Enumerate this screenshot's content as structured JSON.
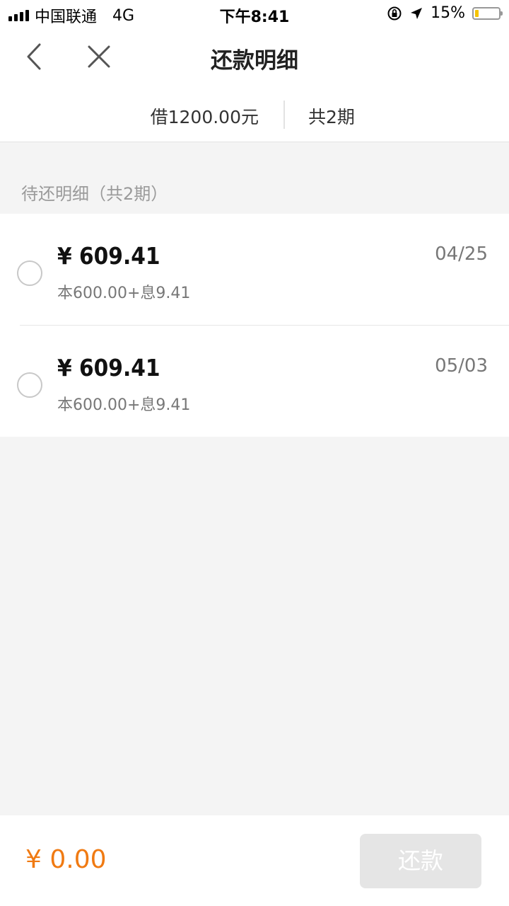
{
  "status_bar": {
    "carrier": "中国联通",
    "network": "4G",
    "time": "下午8:41",
    "battery_percent": "15%",
    "battery_level": 0.15,
    "icons": [
      "signal-icon",
      "orientation-lock-icon",
      "location-arrow-icon",
      "battery-icon"
    ]
  },
  "nav": {
    "title": "还款明细",
    "back_icon": "chevron-left-icon",
    "close_icon": "close-icon"
  },
  "summary": {
    "loan": "借1200.00元",
    "periods": "共2期"
  },
  "section": {
    "title": "待还明细（共2期）"
  },
  "installments": [
    {
      "amount": "¥ 609.41",
      "detail": "本600.00+息9.41",
      "date": "04/25"
    },
    {
      "amount": "¥ 609.41",
      "detail": "本600.00+息9.41",
      "date": "05/03"
    }
  ],
  "footer": {
    "total": "¥ 0.00",
    "pay_label": "还款"
  },
  "colors": {
    "accent": "#f07a12",
    "button_disabled": "#e5e5e5",
    "battery_fill": "#f5c400",
    "background": "#f4f4f4"
  }
}
